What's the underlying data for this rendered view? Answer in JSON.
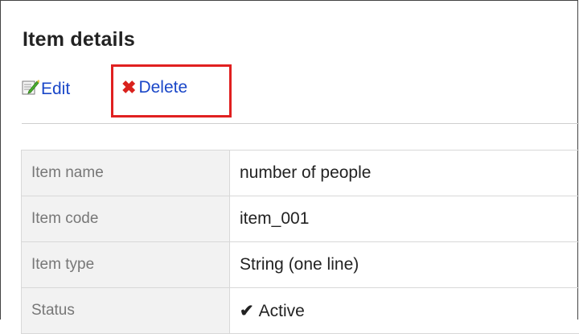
{
  "page": {
    "title": "Item details"
  },
  "toolbar": {
    "edit_label": "Edit",
    "delete_label": "Delete",
    "delete_icon": "✖"
  },
  "details": {
    "rows": [
      {
        "label": "Item name",
        "value": "number of people"
      },
      {
        "label": "Item code",
        "value": "item_001"
      },
      {
        "label": "Item type",
        "value": "String (one line)"
      },
      {
        "label": "Status",
        "value": "Active",
        "value_icon": "✔"
      }
    ]
  },
  "colors": {
    "link": "#1a47c8",
    "highlight": "#e02020",
    "delete_icon": "#d9221d",
    "label_bg": "#f2f2f2"
  }
}
